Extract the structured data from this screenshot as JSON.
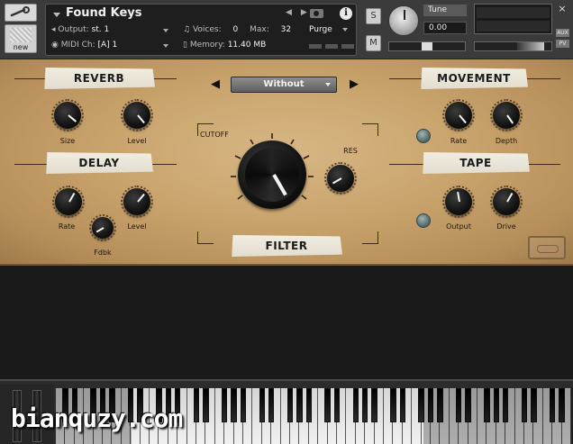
{
  "header": {
    "new_label": "new",
    "instrument_name": "Found Keys",
    "output_label": "Output:",
    "output_value": "st. 1",
    "midi_label": "MIDI Ch:",
    "midi_value": "[A] 1",
    "voices_label": "Voices:",
    "voices_value": "0",
    "max_label": "Max:",
    "max_value": "32",
    "memory_label": "Memory:",
    "memory_value": "11.40 MB",
    "purge_label": "Purge",
    "solo_label": "S",
    "mute_label": "M",
    "tune_label": "Tune",
    "tune_value": "0.00",
    "aux_label": "AUX",
    "pv_label": "PV",
    "close_label": "×"
  },
  "panel": {
    "reverb": {
      "title": "REVERB",
      "size_label": "Size",
      "level_label": "Level"
    },
    "delay": {
      "title": "DELAY",
      "rate_label": "Rate",
      "level_label": "Level",
      "fdbk_label": "Fdbk"
    },
    "filter": {
      "title": "FILTER",
      "cutoff_label": "CUTOFF",
      "res_label": "RES",
      "preset_value": "Without"
    },
    "movement": {
      "title": "MOVEMENT",
      "rate_label": "Rate",
      "depth_label": "Depth"
    },
    "tape": {
      "title": "TAPE",
      "output_label": "Output",
      "drive_label": "Drive"
    }
  },
  "watermark": "bianquzy.com",
  "colors": {
    "panel": "#c9a36c",
    "tape": "#ece8dc",
    "header": "#3b3b3b"
  }
}
